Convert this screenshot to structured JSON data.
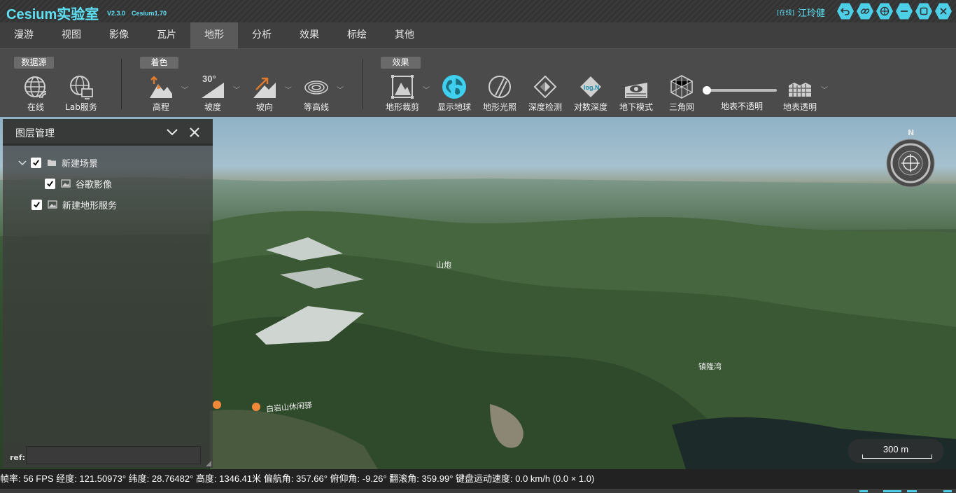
{
  "app": {
    "title": "Cesium实验室",
    "version": "V2.3.0",
    "engine": "Cesium1.70",
    "user_status": "[在线]",
    "user_name": "江玲健",
    "accent": "#4ecfe8"
  },
  "window_buttons": [
    "undo-icon",
    "link-icon",
    "globe-icon",
    "minimize-icon",
    "maximize-icon",
    "close-icon"
  ],
  "menu": {
    "tabs": [
      "漫游",
      "视图",
      "影像",
      "瓦片",
      "地形",
      "分析",
      "效果",
      "标绘",
      "其他"
    ],
    "active": "地形"
  },
  "toolbar": {
    "groups": {
      "datasource": "数据源",
      "coloring": "着色",
      "effects": "效果"
    },
    "tools": {
      "online": "在线",
      "lab_service": "Lab服务",
      "elevation": "高程",
      "slope": "坡度",
      "aspect": "坡向",
      "contour": "等高线",
      "terrain_clip": "地形裁剪",
      "show_globe": "显示地球",
      "terrain_lighting": "地形光照",
      "depth_test": "深度检测",
      "log_depth": "对数深度",
      "underground": "地下模式",
      "triangle_mesh": "三角网",
      "surface_opacity_slider": "地表不透明",
      "surface_transparent": "地表透明"
    },
    "slope_icon_text": "30°",
    "log_icon_text": "log.N",
    "surface_opacity": 0.0
  },
  "layer_panel": {
    "title": "图层管理",
    "items": [
      {
        "label": "新建场景",
        "checked": true,
        "type": "folder"
      },
      {
        "label": "谷歌影像",
        "checked": true,
        "type": "image"
      },
      {
        "label": "新建地形服务",
        "checked": true,
        "type": "image"
      }
    ],
    "ref_label": "ref:",
    "ref_value": ""
  },
  "map": {
    "labels": [
      "山炮",
      "白岩山休闲驿",
      "镇隆湾"
    ],
    "compass_north": "N",
    "scale": "300 m"
  },
  "status": {
    "text": "帧率: 56 FPS 经度: 121.50973° 纬度: 28.76482° 高度: 1346.41米 偏航角: 357.66° 俯仰角: -9.26° 翻滚角: 359.99° 键盘运动速度: 0.0 km/h (0.0 × 1.0)"
  }
}
